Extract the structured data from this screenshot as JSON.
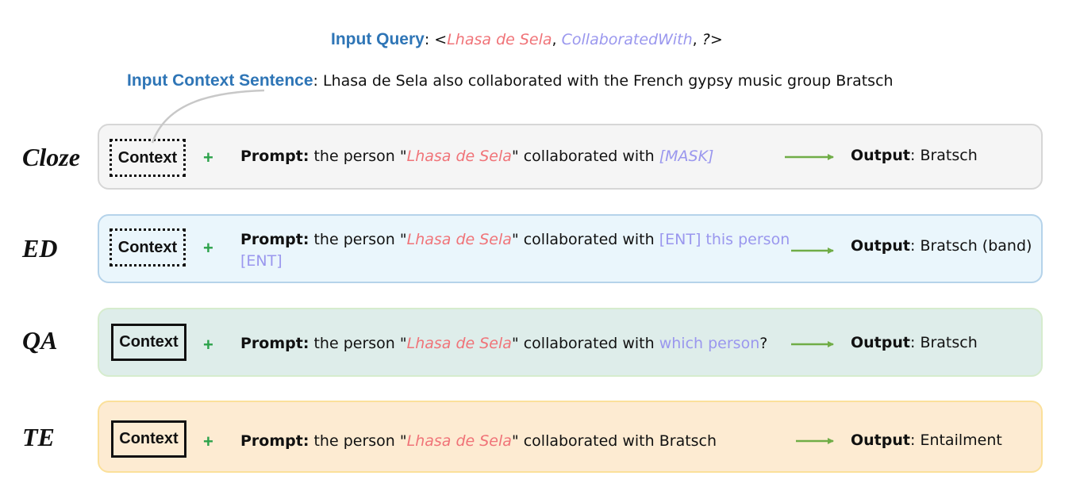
{
  "query": {
    "label": "Input Query",
    "sep": ": <",
    "subject": "Lhasa de Sela",
    "comma1": ", ",
    "relation": "CollaboratedWith",
    "comma2": ", ",
    "object": "?",
    "close": ">"
  },
  "context_sentence": {
    "label": "Input Context Sentence",
    "sep": ": ",
    "text": "Lhasa de Sela also collaborated with the French gypsy music group Bratsch"
  },
  "common": {
    "context": "Context",
    "plus": "+",
    "prompt_label": "Prompt:",
    "output_label": "Output",
    "prompt_pre": " the person \"",
    "subject": "Lhasa de Sela",
    "prompt_mid": "\" collaborated with ",
    "output_sep": ": "
  },
  "rows": {
    "cloze": {
      "task": "Cloze",
      "slot": "[MASK]",
      "output": "Bratsch"
    },
    "ed": {
      "task": "ED",
      "slot": "[ENT] this person [ENT]",
      "output": "Bratsch (band)"
    },
    "qa": {
      "task": "QA",
      "slot": "which person",
      "tail": "?",
      "output": "Bratsch"
    },
    "te": {
      "task": "TE",
      "slot": "Bratsch",
      "output": "Entailment"
    }
  },
  "colors": {
    "title_blue": "#2e75b6",
    "subject_red": "#f07378",
    "relation_purple": "#9a97ee",
    "plus_green": "#2ca24b",
    "arrow_green": "#70ad47"
  }
}
